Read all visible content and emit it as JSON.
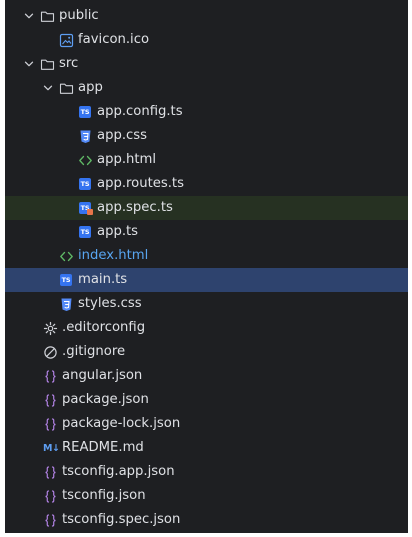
{
  "tree": [
    {
      "id": "public",
      "label": "public",
      "kind": "folder",
      "depth": 0,
      "expanded": true
    },
    {
      "id": "favicon",
      "label": "favicon.ico",
      "kind": "image",
      "depth": 1
    },
    {
      "id": "src",
      "label": "src",
      "kind": "folder",
      "depth": 0,
      "expanded": true
    },
    {
      "id": "app",
      "label": "app",
      "kind": "folder",
      "depth": 1,
      "expanded": true
    },
    {
      "id": "app-config-ts",
      "label": "app.config.ts",
      "kind": "ts",
      "depth": 2
    },
    {
      "id": "app-css",
      "label": "app.css",
      "kind": "css",
      "depth": 2
    },
    {
      "id": "app-html",
      "label": "app.html",
      "kind": "html",
      "depth": 2
    },
    {
      "id": "app-routes-ts",
      "label": "app.routes.ts",
      "kind": "ts",
      "depth": 2
    },
    {
      "id": "app-spec-ts",
      "label": "app.spec.ts",
      "kind": "spec",
      "depth": 2,
      "state": "highlight"
    },
    {
      "id": "app-ts",
      "label": "app.ts",
      "kind": "ts",
      "depth": 2
    },
    {
      "id": "index-html",
      "label": "index.html",
      "kind": "html",
      "depth": 1,
      "state": "modified"
    },
    {
      "id": "main-ts",
      "label": "main.ts",
      "kind": "ts",
      "depth": 1,
      "state": "selected"
    },
    {
      "id": "styles-css",
      "label": "styles.css",
      "kind": "css",
      "depth": 1
    },
    {
      "id": "editorconfig",
      "label": ".editorconfig",
      "kind": "config",
      "depth": 0
    },
    {
      "id": "gitignore",
      "label": ".gitignore",
      "kind": "ignore",
      "depth": 0
    },
    {
      "id": "angular-json",
      "label": "angular.json",
      "kind": "json",
      "depth": 0
    },
    {
      "id": "package-json",
      "label": "package.json",
      "kind": "json",
      "depth": 0
    },
    {
      "id": "package-lock-json",
      "label": "package-lock.json",
      "kind": "json",
      "depth": 0
    },
    {
      "id": "readme-md",
      "label": "README.md",
      "kind": "md",
      "depth": 0
    },
    {
      "id": "tsconfig-app-json",
      "label": "tsconfig.app.json",
      "kind": "json",
      "depth": 0
    },
    {
      "id": "tsconfig-json",
      "label": "tsconfig.json",
      "kind": "json",
      "depth": 0
    },
    {
      "id": "tsconfig-spec-json",
      "label": "tsconfig.spec.json",
      "kind": "json",
      "depth": 0
    }
  ],
  "badges": {
    "ts": "TS",
    "md": "M↓"
  },
  "colors": {
    "background": "#1e1f22",
    "selected_row": "#2e436e",
    "highlight_row": "#263122",
    "text": "#dfe1e5",
    "modified_text": "#58a5f0",
    "ts_icon": "#3574f0",
    "json_icon": "#b383e6",
    "html_icon": "#5fb865"
  }
}
